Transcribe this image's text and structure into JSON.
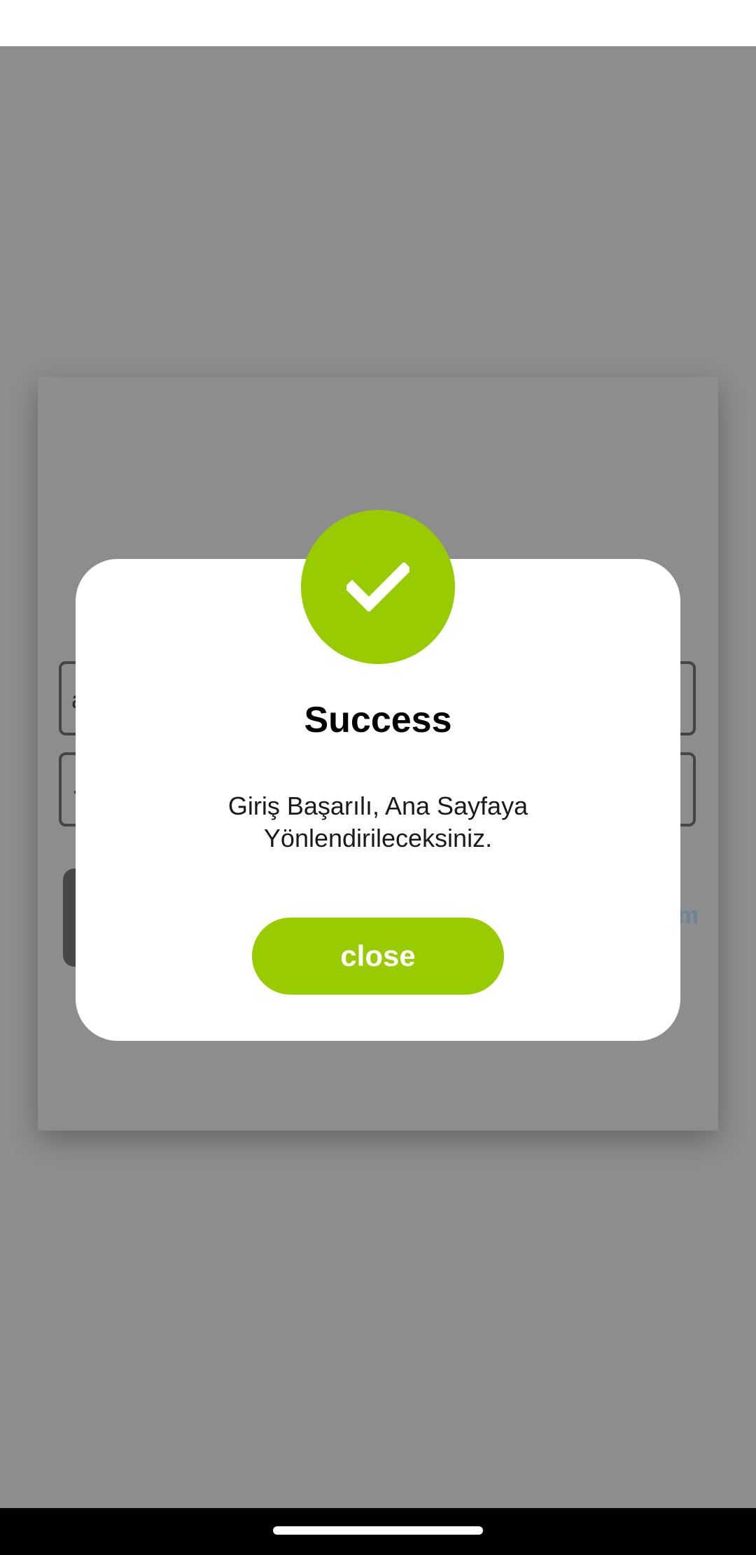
{
  "background": {
    "username_field_char": "a",
    "password_field_char": "·",
    "link_text": "m"
  },
  "dialog": {
    "icon": "checkmark-icon",
    "title": "Success",
    "message_line1": "Giriş Başarılı, Ana Sayfaya",
    "message_line2": "Yönlendirileceksiniz.",
    "close_label": "close"
  },
  "colors": {
    "accent": "#99cc00",
    "overlay": "#8e8e8e",
    "dialog_bg": "#ffffff",
    "link": "#6b8596"
  }
}
